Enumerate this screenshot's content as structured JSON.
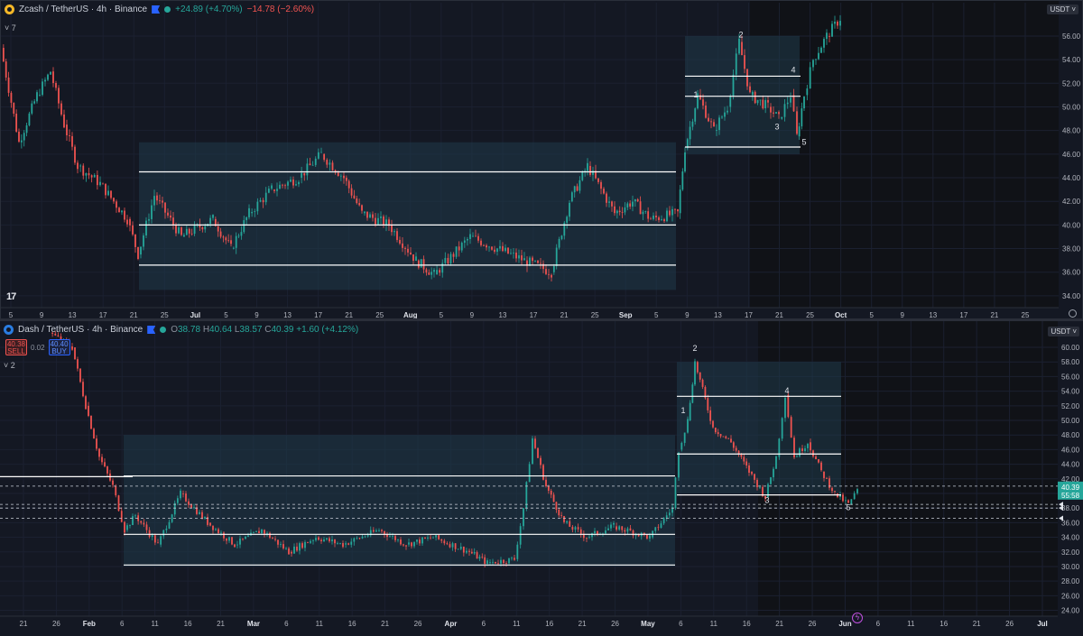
{
  "top_chart": {
    "legend": {
      "symbol": "Zcash / TetherUS · 4h · Binance",
      "change_up": "+24.89 (+4.70%)",
      "change_down": "−14.78 (−2.60%)"
    },
    "indicator_count": "7",
    "currency": "USDT",
    "price_ticks": [
      "56.00",
      "54.00",
      "52.00",
      "50.00",
      "48.00",
      "46.00",
      "44.00",
      "42.00",
      "40.00",
      "38.00",
      "36.00",
      "34.00"
    ],
    "price_range": [
      33,
      57.6
    ],
    "time_ticks": [
      "5",
      "9",
      "13",
      "17",
      "21",
      "25",
      "Jul",
      "5",
      "9",
      "13",
      "17",
      "21",
      "25",
      "Aug",
      "5",
      "9",
      "13",
      "17",
      "21",
      "25",
      "Sep",
      "5",
      "9",
      "13",
      "17",
      "21",
      "25",
      "Oct",
      "5",
      "9",
      "13",
      "17",
      "21",
      "25"
    ],
    "bold_ticks": [
      "Jul",
      "Aug",
      "Sep",
      "Oct"
    ],
    "wave_labels": [
      "1",
      "2",
      "3",
      "4",
      "5"
    ],
    "levels": {
      "range_box": [
        34.5,
        47.0
      ],
      "range_lines": [
        44.5,
        40.0,
        36.6
      ],
      "upper_box": [
        46.0,
        56.0
      ],
      "upper_lines": [
        52.6,
        50.9,
        46.6
      ]
    }
  },
  "bottom_chart": {
    "legend": {
      "symbol": "Dash / TetherUS · 4h · Binance",
      "open": "38.78",
      "high": "40.64",
      "low": "38.57",
      "close": "40.39",
      "change": "+1.60 (+4.12%)"
    },
    "trade": {
      "sell_price": "40.38",
      "sell_label": "SELL",
      "spread": "0.02",
      "buy_price": "40.40",
      "buy_label": "BUY"
    },
    "indicator_count": "2",
    "currency": "USDT",
    "price_ticks": [
      "60.00",
      "58.00",
      "56.00",
      "54.00",
      "52.00",
      "50.00",
      "48.00",
      "46.00",
      "44.00",
      "42.00",
      "40.00",
      "38.00",
      "36.00",
      "34.00",
      "32.00",
      "30.00",
      "28.00",
      "26.00",
      "24.00"
    ],
    "price_range": [
      23.2,
      62.6
    ],
    "current_price": "40.39",
    "current_countdown": "55:58",
    "time_ticks": [
      "21",
      "26",
      "Feb",
      "6",
      "11",
      "16",
      "21",
      "Mar",
      "6",
      "11",
      "16",
      "21",
      "26",
      "Apr",
      "6",
      "11",
      "16",
      "21",
      "26",
      "May",
      "6",
      "11",
      "16",
      "21",
      "26",
      "Jun",
      "6",
      "11",
      "16",
      "21",
      "26",
      "Jul"
    ],
    "bold_ticks": [
      "Feb",
      "Mar",
      "Apr",
      "May",
      "Jun",
      "Jul"
    ],
    "wave_labels": [
      "1",
      "2",
      "3",
      "4",
      "5"
    ],
    "levels": {
      "range_box": [
        30.0,
        48.0
      ],
      "range_lines": [
        42.4,
        34.4,
        30.2
      ],
      "upper_box": [
        40.0,
        58.0
      ],
      "upper_lines": [
        53.3,
        45.4,
        39.8
      ],
      "left_line": 42.3,
      "dashed_lines": [
        41.0,
        38.5,
        38.0,
        36.6
      ]
    }
  },
  "colors": {
    "up": "#26a69a",
    "down": "#ef5350",
    "box": "#1f3a4a",
    "line": "#ffffff",
    "background": "#141823"
  }
}
